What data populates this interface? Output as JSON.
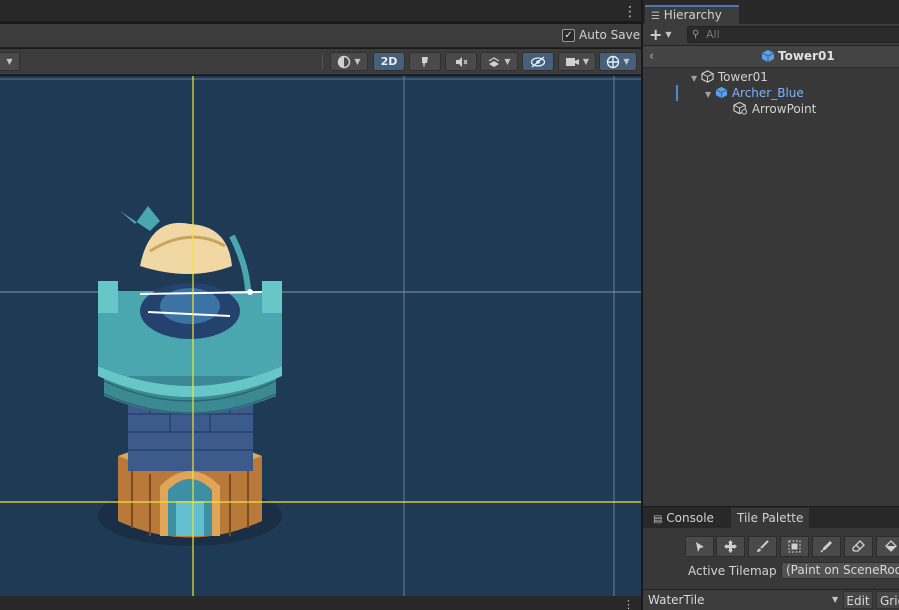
{
  "scene": {
    "auto_save_label": "Auto Save",
    "auto_save_checked": "✓",
    "view_2d_label": "2D"
  },
  "hierarchy": {
    "tab_label": "Hierarchy",
    "search_placeholder": "All",
    "header_title": "Tower01",
    "items": [
      {
        "label": "Tower01"
      },
      {
        "label": "Archer_Blue"
      },
      {
        "label": "ArrowPoint"
      }
    ]
  },
  "bottom_panel": {
    "tabs": [
      {
        "label": "Console"
      },
      {
        "label": "Tile Palette"
      }
    ],
    "active_tilemap_label": "Active Tilemap",
    "active_tilemap_value": "(Paint on SceneRoo",
    "palette_value": "WaterTile",
    "edit_label": "Edit",
    "grid_label": "Grid"
  },
  "colors": {
    "scene_background": "#1f3a55",
    "guide_line": "#f3e33a",
    "selected_object": "#7fb2ff",
    "accent_tab": "#4a76b4"
  },
  "icons": [
    "kebab-menu-icon",
    "shading-mode-icon",
    "lighting-icon",
    "audio-mute-icon",
    "effects-icon",
    "visibility-icon",
    "camera-icon",
    "gizmos-icon",
    "plus-icon",
    "search-icon",
    "back-icon",
    "cube-icon",
    "prefab-cube-icon",
    "select-tool-icon",
    "move-tool-icon",
    "brush-tool-icon",
    "box-fill-tool-icon",
    "picker-tool-icon",
    "eraser-tool-icon",
    "fill-tool-icon"
  ]
}
